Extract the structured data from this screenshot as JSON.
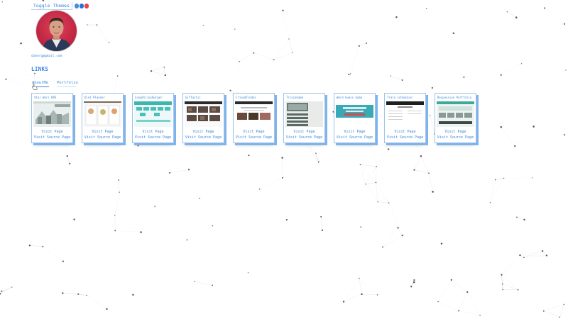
{
  "header": {
    "toggle_label": "Toggle Themes"
  },
  "theme_dots": [
    {
      "name": "theme-dot-blue-1",
      "color": "#3d8fe6"
    },
    {
      "name": "theme-dot-blue-2",
      "color": "#2f6fd1"
    },
    {
      "name": "theme-dot-red",
      "color": "#e0454a"
    }
  ],
  "profile": {
    "email": "dzmorg@gmail.com"
  },
  "links_heading": "LINKS",
  "tabs": {
    "about": "AboutMe",
    "portfolio": "Portfolio"
  },
  "cards": [
    {
      "title": "Star Wars RPG",
      "thumb": "rpg",
      "visit": "Visit Page",
      "source": "Visit Source Page"
    },
    {
      "title": "Diet Planner",
      "thumb": "diet",
      "visit": "Visit Page",
      "source": "Visit Source Page"
    },
    {
      "title": "LongAlliesBurger",
      "thumb": "burger",
      "visit": "Visit Page",
      "source": "Visit Source Page"
    },
    {
      "title": "GifTastic",
      "thumb": "gif",
      "visit": "Visit Page",
      "source": "Visit Source Page"
    },
    {
      "title": "FriendFinder",
      "thumb": "friend",
      "visit": "Visit Page",
      "source": "Visit Source Page"
    },
    {
      "title": "TriviaGame",
      "thumb": "trivia",
      "visit": "Visit Page",
      "source": "Visit Source Page"
    },
    {
      "title": "Word Guess Game",
      "thumb": "word",
      "visit": "Visit Page",
      "source": "Visit Source Page"
    },
    {
      "title": "Train scheduler",
      "thumb": "train",
      "visit": "Visit Page",
      "source": "Visit Source Page"
    },
    {
      "title": "Responsive Portfolio",
      "thumb": "portfolio",
      "visit": "Visit Page",
      "source": "Visit Source Page"
    }
  ]
}
